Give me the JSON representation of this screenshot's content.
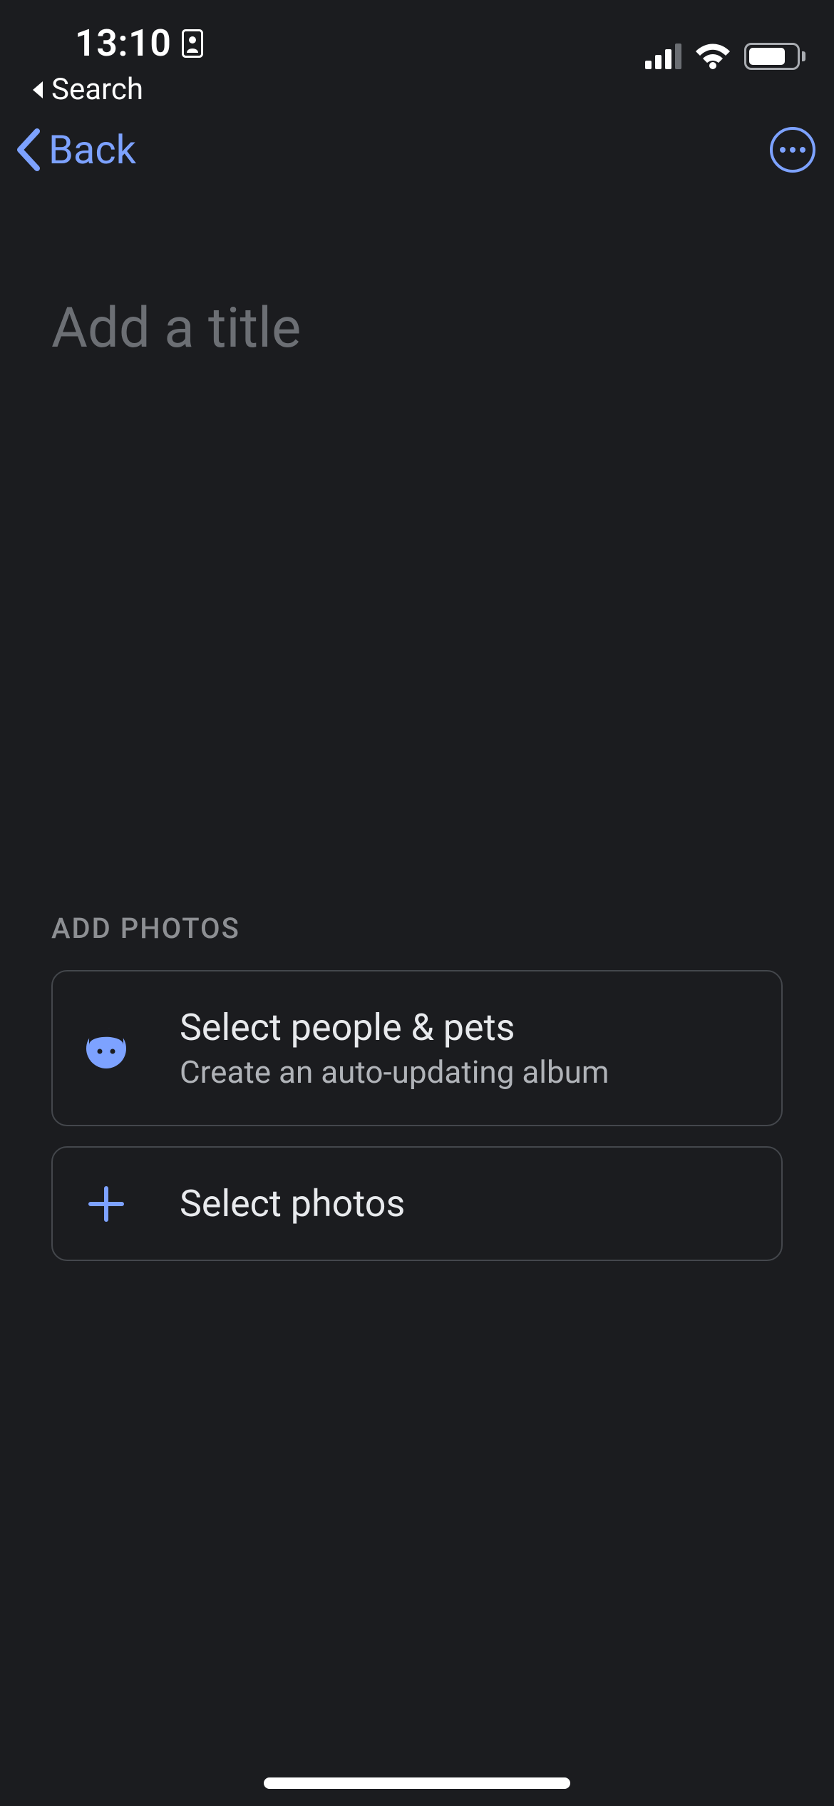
{
  "statusbar": {
    "time": "13:10",
    "breadcrumb": "Search"
  },
  "nav": {
    "back_label": "Back"
  },
  "title": {
    "placeholder": "Add a title",
    "value": ""
  },
  "section": {
    "header": "ADD PHOTOS",
    "options": [
      {
        "title": "Select people & pets",
        "subtitle": "Create an auto-updating album"
      },
      {
        "title": "Select photos"
      }
    ]
  }
}
